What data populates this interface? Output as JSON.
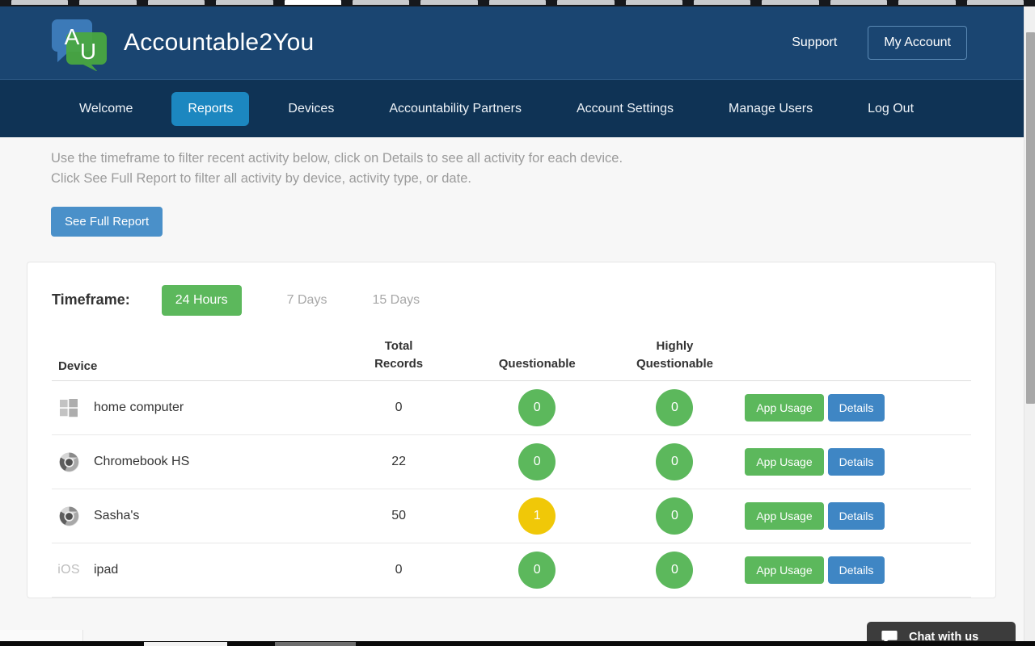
{
  "browser": {
    "tabs": [
      {
        "active": false
      },
      {
        "active": false
      },
      {
        "active": false
      },
      {
        "active": false
      },
      {
        "active": true
      },
      {
        "active": false
      },
      {
        "active": false
      },
      {
        "active": false
      },
      {
        "active": false
      },
      {
        "active": false
      },
      {
        "active": false
      },
      {
        "active": false
      },
      {
        "active": false
      },
      {
        "active": false
      },
      {
        "active": false
      }
    ]
  },
  "header": {
    "brand_name": "Accountable2You",
    "logo_icon": "speech-bubble-logo",
    "logo_letter_a": "A",
    "logo_letter_u": "U",
    "support_label": "Support",
    "account_label": "My Account",
    "background_color": "#1a4571"
  },
  "nav": {
    "background_color": "#0f3355",
    "active_color": "#1c87c0",
    "items": [
      {
        "label": "Welcome",
        "active": false
      },
      {
        "label": "Reports",
        "active": true
      },
      {
        "label": "Devices",
        "active": false
      },
      {
        "label": "Accountability Partners",
        "active": false
      },
      {
        "label": "Account Settings",
        "active": false
      },
      {
        "label": "Manage Users",
        "active": false
      },
      {
        "label": "Log Out",
        "active": false
      }
    ]
  },
  "intro": {
    "line1": "Use the timeframe to filter recent activity below, click on Details to see all activity for each device.",
    "line2": "Click See Full Report to filter all activity by device, activity type, or date.",
    "full_report_button": "See Full Report"
  },
  "timeframe": {
    "label": "Timeframe:",
    "options": [
      {
        "label": "24 Hours",
        "active": true
      },
      {
        "label": "7 Days",
        "active": false
      },
      {
        "label": "15 Days",
        "active": false
      }
    ],
    "active_color": "#5cb85c"
  },
  "table": {
    "headers": {
      "device": "Device",
      "total_line1": "Total",
      "total_line2": "Records",
      "questionable": "Questionable",
      "highly_line1": "Highly",
      "highly_line2": "Questionable"
    },
    "action_labels": {
      "app_usage": "App Usage",
      "details": "Details"
    },
    "rows": [
      {
        "icon": "windows-icon",
        "device": "home computer",
        "total_records": "0",
        "questionable": "0",
        "questionable_color": "green",
        "highly_questionable": "0",
        "highly_questionable_color": "green"
      },
      {
        "icon": "chrome-icon",
        "device": "Chromebook HS",
        "total_records": "22",
        "questionable": "0",
        "questionable_color": "green",
        "highly_questionable": "0",
        "highly_questionable_color": "green"
      },
      {
        "icon": "chrome-icon",
        "device": "Sasha's",
        "total_records": "50",
        "questionable": "1",
        "questionable_color": "yellow",
        "highly_questionable": "0",
        "highly_questionable_color": "green"
      },
      {
        "icon": "ios-icon",
        "icon_text": "iOS",
        "device": "ipad",
        "total_records": "0",
        "questionable": "0",
        "questionable_color": "green",
        "highly_questionable": "0",
        "highly_questionable_color": "green"
      }
    ]
  },
  "chat": {
    "label": "Chat with us",
    "icon": "chat-bubble-icon",
    "background_color": "#3c3c3c"
  },
  "colors": {
    "green": "#5cb85c",
    "yellow": "#f0c808",
    "blue": "#3f86c4",
    "header_blue": "#1a4571",
    "nav_blue": "#0f3355"
  }
}
